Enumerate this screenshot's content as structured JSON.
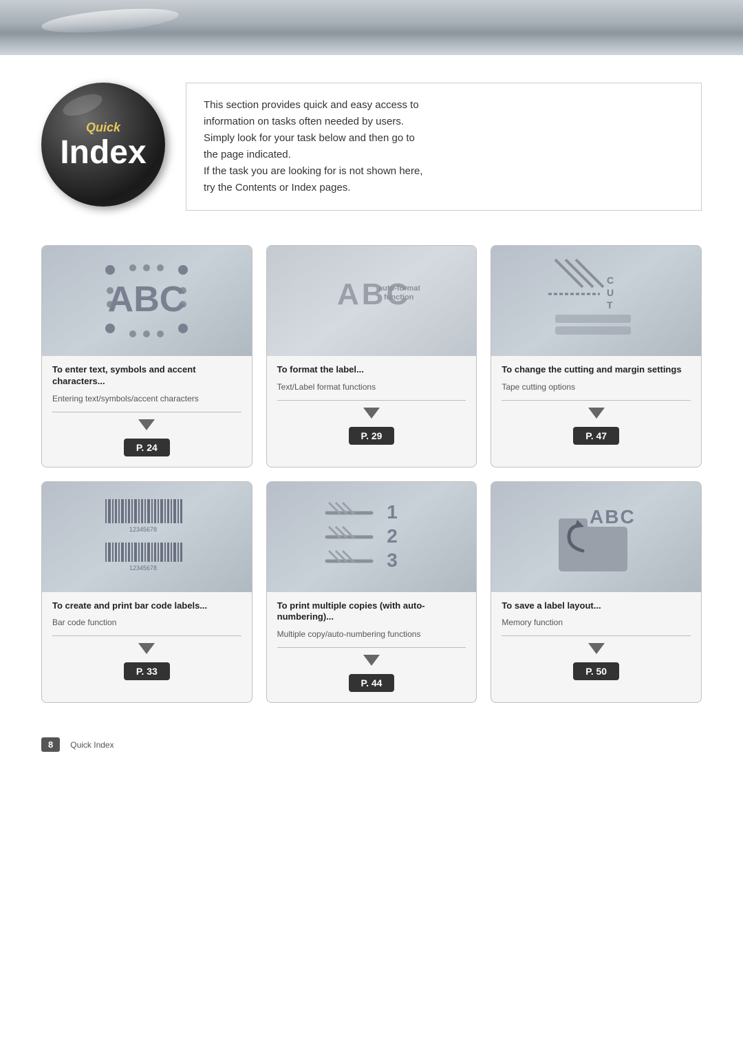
{
  "banner": {
    "visible": true
  },
  "header": {
    "orb": {
      "quick_label": "Quick",
      "index_label": "Index"
    },
    "description": {
      "line1": "This section provides quick and easy access to",
      "line2": "information on tasks often needed by users.",
      "line3": "Simply look for your task below and then go to",
      "line4": "the page indicated.",
      "line5": "If the task you are looking for is not shown here,",
      "line6": "try the Contents or Index pages."
    }
  },
  "cards": [
    {
      "id": "card-1",
      "title": "To enter text, symbols and accent characters...",
      "subtitle": "Entering text/symbols/accent characters",
      "page": "P. 24"
    },
    {
      "id": "card-2",
      "title": "To format the label...",
      "subtitle": "Text/Label format functions",
      "page": "P. 29"
    },
    {
      "id": "card-3",
      "title": "To change the cutting and margin settings",
      "subtitle": "Tape cutting options",
      "page": "P. 47"
    },
    {
      "id": "card-4",
      "title": "To create and print bar code labels...",
      "subtitle": "Bar code function",
      "page": "P. 33"
    },
    {
      "id": "card-5",
      "title": "To print multiple copies (with auto-numbering)...",
      "subtitle": "Multiple copy/auto-numbering functions",
      "page": "P. 44"
    },
    {
      "id": "card-6",
      "title": "To save a label layout...",
      "subtitle": "Memory function",
      "page": "P. 50"
    }
  ],
  "footer": {
    "page_number": "8",
    "label": "Quick Index"
  },
  "barcode_number": "12345678",
  "autoformat_sub": "auto-format\nfunction",
  "numbers": [
    "1",
    "2",
    "3"
  ]
}
